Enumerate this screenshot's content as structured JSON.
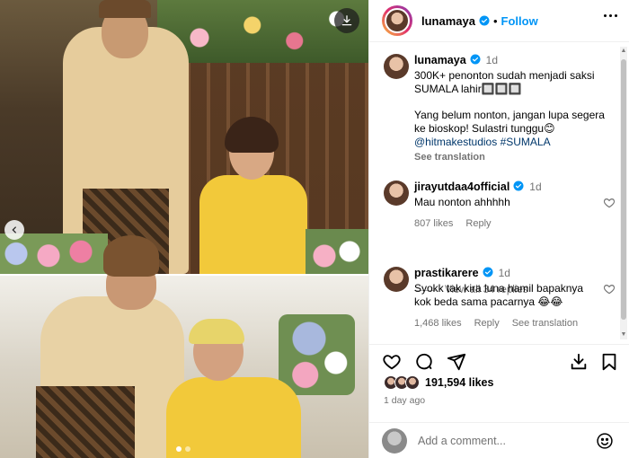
{
  "post": {
    "username": "lunamaya",
    "follow_label": "Follow",
    "separator": "•",
    "caption": {
      "username": "lunamaya",
      "time": "1d",
      "line1": "300K+ penonton sudah menjadi saksi",
      "line2": "SUMALA lahir🔲🔲🔲",
      "line3": "Yang belum nonton, jangan lupa segera",
      "line4": "ke bioskop! Sulastri tunggu😊",
      "mention": "@hitmakestudios",
      "hashtag": "#SUMALA",
      "see_translation": "See translation"
    },
    "comments": [
      {
        "username": "jirayutdaa4official",
        "time": "1d",
        "text": "Mau nonton ahhhhh",
        "likes": "807 likes",
        "reply": "Reply"
      },
      {
        "username": "prastikarere",
        "time": "1d",
        "text_line1": "Syokk tak kira luna hamil bapaknya",
        "text_line2": "kok beda sama pacarnya 😂😂",
        "likes": "1,468 likes",
        "reply": "Reply",
        "see_translation": "See translation"
      }
    ],
    "view_replies": "View all 34 replies",
    "likes_count": "191,594 likes",
    "date": "1 day ago",
    "add_comment_placeholder": "Add a comment..."
  },
  "icons": {
    "verified": "verified-badge-icon",
    "download": "download-icon",
    "prev": "chevron-left-icon",
    "heart": "heart-icon",
    "comment": "comment-icon",
    "share": "send-icon",
    "save": "bookmark-icon",
    "repost": "repost-icon",
    "emoji": "emoji-icon",
    "more": "more-icon"
  },
  "colors": {
    "accent": "#0095f6",
    "verified": "#0095f6",
    "muted": "#737373"
  }
}
